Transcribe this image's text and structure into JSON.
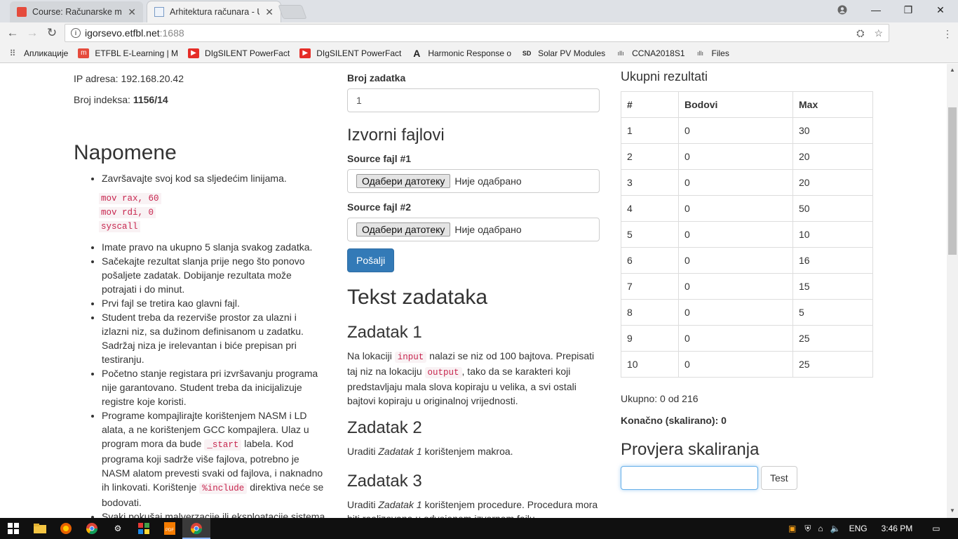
{
  "browser": {
    "tabs": [
      {
        "title": "Course: Računarske mrež",
        "active": false
      },
      {
        "title": "Arhitektura računara - Up",
        "active": true
      }
    ],
    "url_host": "igorsevo.etfbl.net",
    "url_port": ":1688",
    "bookmarks": [
      {
        "label": "Апликације",
        "icon": "apps-grid-icon"
      },
      {
        "label": "ETFBL E-Learning | M",
        "icon": "moodle-icon"
      },
      {
        "label": "DIgSILENT PowerFact",
        "icon": "youtube-icon"
      },
      {
        "label": "DIgSILENT PowerFact",
        "icon": "youtube-icon"
      },
      {
        "label": "Harmonic Response o",
        "icon": "ansys-icon"
      },
      {
        "label": "Solar PV Modules",
        "icon": "sd-icon"
      },
      {
        "label": "CCNA2018S1",
        "icon": "cisco-icon"
      },
      {
        "label": "Files",
        "icon": "cisco-icon"
      }
    ]
  },
  "left": {
    "ip_label": "IP adresa: 192.168.20.42",
    "index_label": "Broj indeksa: ",
    "index_value": "1156/14",
    "notes_title": "Napomene",
    "note1": "Završavajte svoj kod sa sljedećim linijama.",
    "code_lines": [
      "mov rax, 60",
      "mov rdi, 0",
      "syscall"
    ],
    "note2": "Imate pravo na ukupno 5 slanja svakog zadatka.",
    "note3": "Sačekajte rezultat slanja prije nego što ponovo pošaljete zadatak. Dobijanje rezultata može potrajati i do minut.",
    "note4": "Prvi fajl se tretira kao glavni fajl.",
    "note5": "Student treba da rezerviše prostor za ulazni i izlazni niz, sa dužinom definisanom u zadatku. Sadržaj niza je irelevantan i biće prepisan pri testiranju.",
    "note6": "Početno stanje registara pri izvršavanju programa nije garantovano. Student treba da inicijalizuje registre koje koristi.",
    "note7_a": "Programe kompajlirajte korištenjem NASM i LD alata, a ne korištenjem GCC kompajlera. Ulaz u program mora da bude ",
    "note7_code1": "_start",
    "note7_b": " labela. Kod programa koji sadrže više fajlova, potrebno je NASM alatom prevesti svaki od fajlova, i naknadno ih linkovati. Korištenje ",
    "note7_code2": "%include",
    "note7_c": " direktiva neće se bodovati.",
    "note8": "Svaki pokušaj malverzacije ili eksploatacije sistema"
  },
  "middle": {
    "task_number_label": "Broj zadatka",
    "task_number_value": "1",
    "sources_title": "Izvorni fajlovi",
    "source1_label": "Source fajl #1",
    "source2_label": "Source fajl #2",
    "file_button": "Одабери датотеку",
    "file_status": "Није одабрано",
    "submit": "Pošalji",
    "tasks_title": "Tekst zadataka",
    "z1_title": "Zadatak 1",
    "z1_a": "Na lokaciji ",
    "z1_code1": "input",
    "z1_b": " nalazi se niz od 100 bajtova. Prepisati taj niz na lokaciju ",
    "z1_code2": "output",
    "z1_c": ", tako da se karakteri koji predstavljaju mala slova kopiraju u velika, a svi ostali bajtovi kopiraju u originalnoj vrijednosti.",
    "z2_title": "Zadatak 2",
    "z2_a": "Uraditi ",
    "z2_em": "Zadatak 1",
    "z2_b": " korištenjem makroa.",
    "z3_title": "Zadatak 3",
    "z3_a": "Uraditi ",
    "z3_em": "Zadatak 1",
    "z3_b": " korištenjem procedure. Procedura mora biti realizovana u odvojenom izvornom fajlu."
  },
  "right": {
    "results_title": "Ukupni rezultati",
    "headers": [
      "#",
      "Bodovi",
      "Max"
    ],
    "rows": [
      [
        "1",
        "0",
        "30"
      ],
      [
        "2",
        "0",
        "20"
      ],
      [
        "3",
        "0",
        "20"
      ],
      [
        "4",
        "0",
        "50"
      ],
      [
        "5",
        "0",
        "10"
      ],
      [
        "6",
        "0",
        "16"
      ],
      [
        "7",
        "0",
        "15"
      ],
      [
        "8",
        "0",
        "5"
      ],
      [
        "9",
        "0",
        "25"
      ],
      [
        "10",
        "0",
        "25"
      ]
    ],
    "total": "Ukupno: 0 od 216",
    "final": "Konačno (skalirano): 0",
    "scaling_title": "Provjera skaliranja",
    "scaling_input": "",
    "test_button": "Test"
  },
  "taskbar": {
    "lang": "ENG",
    "time": "3:46 PM"
  },
  "colors": {
    "primary": "#337ab7",
    "code_text": "#c7254e",
    "code_bg": "#f9f2f4"
  }
}
